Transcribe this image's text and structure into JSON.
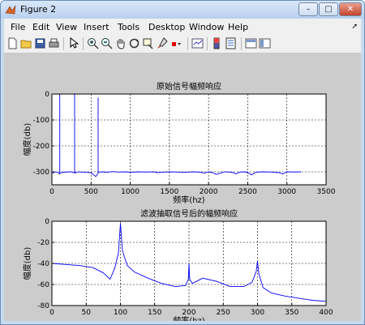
{
  "window": {
    "title": "Figure 2"
  },
  "window_buttons": {
    "minimize": "–",
    "maximize": "□",
    "close": "✕"
  },
  "menu": [
    {
      "label": "File"
    },
    {
      "label": "Edit"
    },
    {
      "label": "View"
    },
    {
      "label": "Insert"
    },
    {
      "label": "Tools"
    },
    {
      "label": "Desktop"
    },
    {
      "label": "Window"
    },
    {
      "label": "Help"
    }
  ],
  "toolbar": [
    {
      "icon": "new-figure-icon"
    },
    {
      "icon": "open-file-icon"
    },
    {
      "icon": "save-icon"
    },
    {
      "icon": "print-icon"
    },
    {
      "icon": "edit-plot-arrow-icon"
    },
    {
      "icon": "zoom-in-icon"
    },
    {
      "icon": "zoom-out-icon"
    },
    {
      "icon": "pan-hand-icon"
    },
    {
      "icon": "rotate-3d-icon"
    },
    {
      "icon": "data-cursor-icon"
    },
    {
      "icon": "brush-icon"
    },
    {
      "icon": "link-plot-icon"
    },
    {
      "icon": "insert-colorbar-icon"
    },
    {
      "icon": "insert-legend-icon"
    },
    {
      "icon": "hide-plot-tools-icon"
    },
    {
      "icon": "show-plot-tools-icon"
    }
  ],
  "colors": {
    "line": "#0000ff",
    "axes_bg": "#ffffff",
    "figure_bg": "#cccccc"
  },
  "chart_data": [
    {
      "type": "line",
      "title": "原始信号幅频响应",
      "xlabel": "频率(hz)",
      "ylabel": "幅度(db)",
      "xlim": [
        0,
        3500
      ],
      "ylim": [
        -350,
        0
      ],
      "xticks": [
        0,
        500,
        1000,
        1500,
        2000,
        2500,
        3000,
        3500
      ],
      "yticks": [
        -300,
        -200,
        -100,
        0
      ],
      "grid": true,
      "series": [
        {
          "color": "#0000ff",
          "x": [
            0,
            60,
            100,
            100,
            100,
            100,
            140,
            240,
            290,
            290,
            290,
            290,
            340,
            420,
            500,
            560,
            590,
            590,
            590,
            590,
            640,
            700,
            780,
            860,
            940,
            1000,
            1100,
            1200,
            1300,
            1350,
            1400,
            1500,
            1600,
            1700,
            1800,
            1900,
            1950,
            2000,
            2050,
            2100,
            2200,
            2300,
            2350,
            2400,
            2450,
            2500,
            2550,
            2600,
            2700,
            2800,
            2900,
            2950,
            3000,
            3100,
            3180
          ],
          "y": [
            -305,
            -300,
            -308,
            0,
            0,
            -305,
            -302,
            -300,
            -304,
            0,
            0,
            -305,
            -300,
            -302,
            -303,
            -318,
            -305,
            -15,
            -15,
            -302,
            -300,
            -302,
            -299,
            -301,
            -300,
            -302,
            -300,
            -301,
            -300,
            -303,
            -302,
            -300,
            -301,
            -302,
            -300,
            -302,
            -305,
            -300,
            -303,
            -310,
            -300,
            -302,
            -308,
            -301,
            -300,
            -303,
            -312,
            -302,
            -300,
            -301,
            -303,
            -308,
            -300,
            -301,
            -300
          ]
        }
      ]
    },
    {
      "type": "line",
      "title": "滤波抽取信号后的幅频响应",
      "xlabel": "频率(hz)",
      "ylabel": "幅度(db)",
      "xlim": [
        0,
        400
      ],
      "ylim": [
        -80,
        0
      ],
      "xticks": [
        0,
        50,
        100,
        150,
        200,
        250,
        300,
        350,
        400
      ],
      "yticks": [
        -80,
        -60,
        -40,
        -20,
        0
      ],
      "grid": true,
      "series": [
        {
          "color": "#0000ff",
          "x": [
            0,
            20,
            40,
            60,
            75,
            85,
            92,
            97,
            100,
            103,
            110,
            120,
            140,
            160,
            180,
            195,
            199,
            200,
            201,
            205,
            220,
            240,
            260,
            280,
            292,
            298,
            300,
            302,
            308,
            320,
            340,
            360,
            380,
            400
          ],
          "y": [
            -40,
            -41,
            -42,
            -44,
            -49,
            -55,
            -44,
            -30,
            -2,
            -28,
            -42,
            -48,
            -54,
            -59,
            -62,
            -61,
            -55,
            -40,
            -55,
            -59,
            -54,
            -57,
            -62,
            -62,
            -58,
            -48,
            -38,
            -50,
            -63,
            -68,
            -71,
            -73,
            -75,
            -76
          ]
        }
      ]
    }
  ]
}
